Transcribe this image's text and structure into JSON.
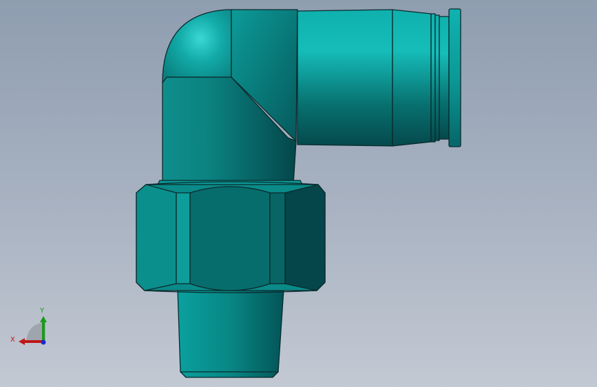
{
  "viewport": {
    "background_top": "#8f9db0",
    "background_bottom": "#c3c9d3"
  },
  "part": {
    "body_color": "#0a9a98",
    "dark_color": "#05484b",
    "edge_color": "#0a2a2c",
    "highlight_color": "#34d2cf"
  },
  "triad": {
    "x_label": "X",
    "y_label": "Y",
    "x_color": "#c01616",
    "y_color": "#1a9a1a",
    "z_color": "#1a2ad0"
  }
}
